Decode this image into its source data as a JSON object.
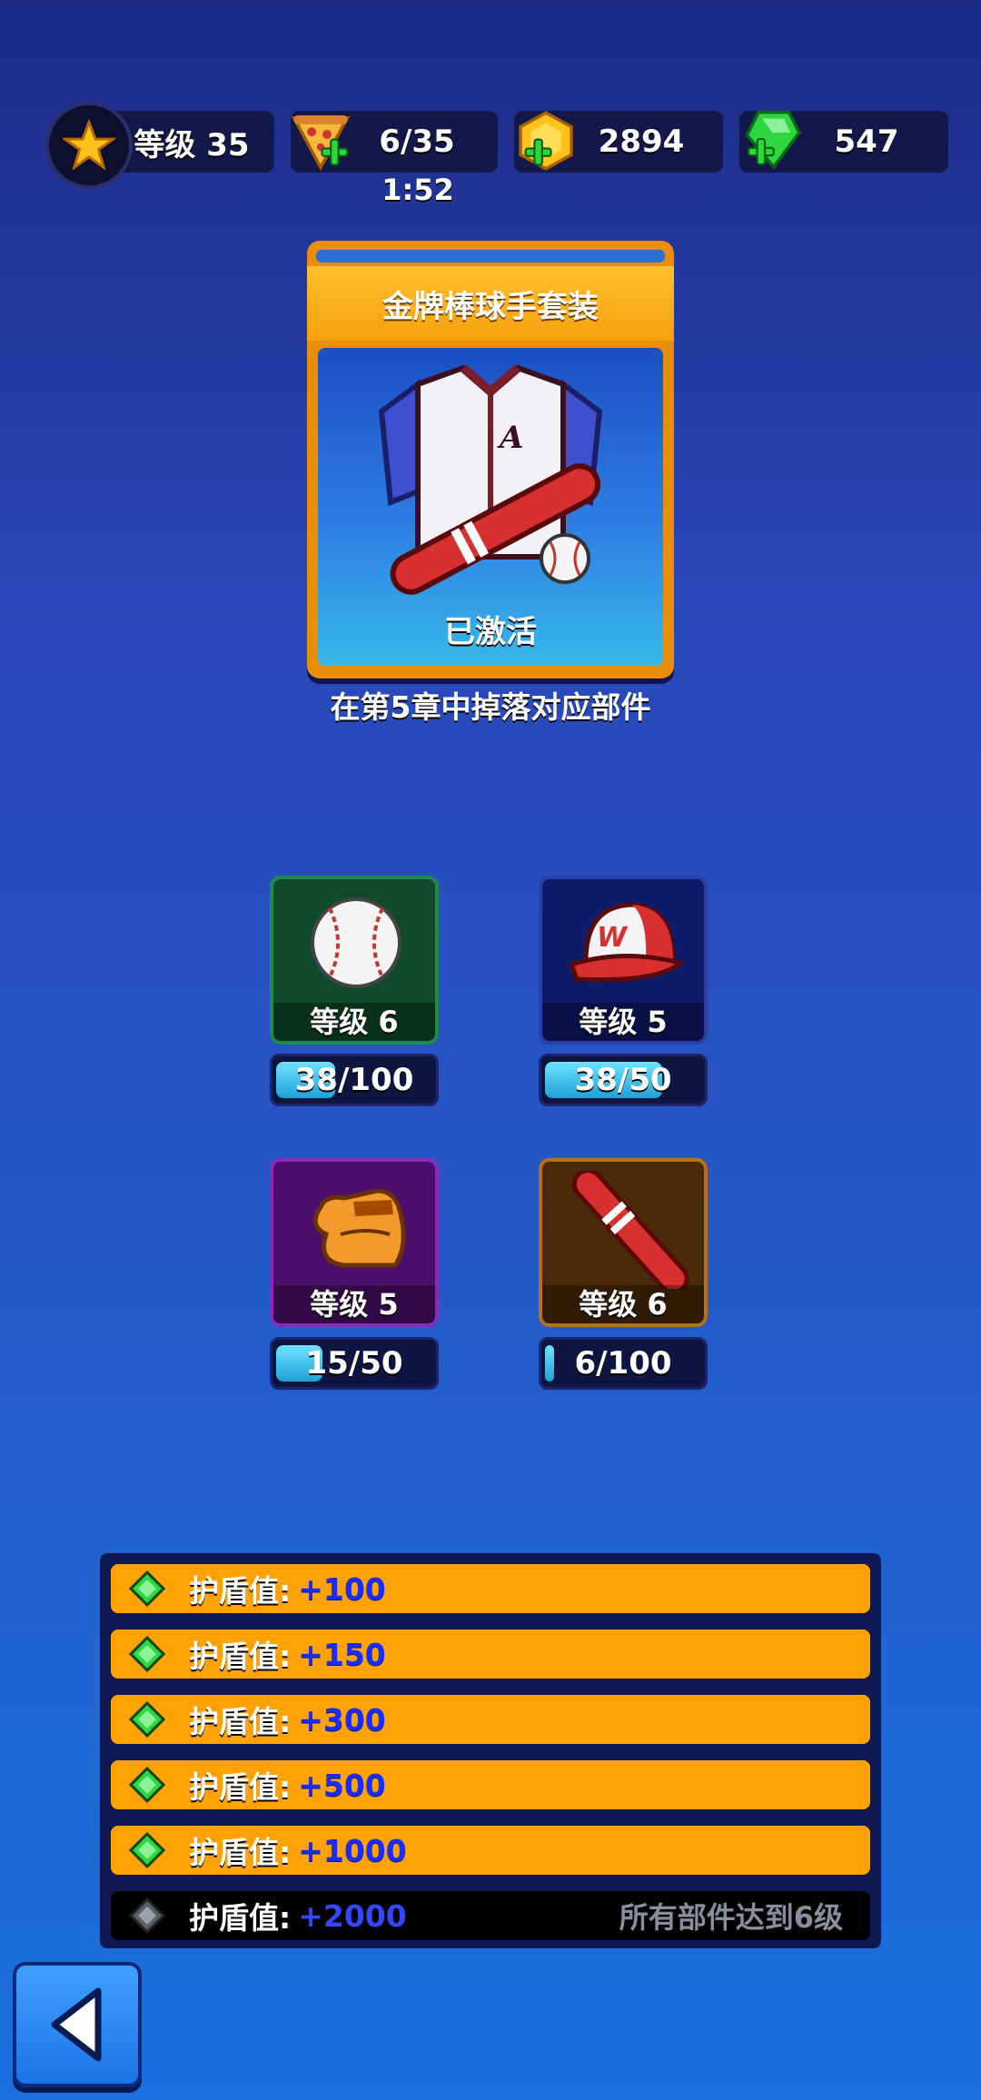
{
  "status_bar": {
    "level_label": "等级 35",
    "energy": "6/35",
    "energy_timer": "1:52",
    "coins": "2894",
    "gems": "547"
  },
  "set_card": {
    "title": "金牌棒球手套装",
    "status": "已激活",
    "drop_hint": "在第5章中掉落对应部件"
  },
  "parts": [
    {
      "name": "baseball",
      "level_label": "等级 6",
      "progress_text": "38/100",
      "progress": 0.38,
      "color": "#0f4a2c"
    },
    {
      "name": "cap",
      "level_label": "等级 5",
      "progress_text": "38/50",
      "progress": 0.76,
      "color": "#0d1b6a"
    },
    {
      "name": "glove",
      "level_label": "等级 5",
      "progress_text": "15/50",
      "progress": 0.3,
      "color": "#4b0f6b"
    },
    {
      "name": "bat",
      "level_label": "等级 6",
      "progress_text": "6/100",
      "progress": 0.06,
      "color": "#4a2a08"
    }
  ],
  "bonuses": [
    {
      "label": "护盾值:",
      "value": "+100",
      "active": true
    },
    {
      "label": "护盾值:",
      "value": "+150",
      "active": true
    },
    {
      "label": "护盾值:",
      "value": "+300",
      "active": true
    },
    {
      "label": "护盾值:",
      "value": "+500",
      "active": true
    },
    {
      "label": "护盾值:",
      "value": "+1000",
      "active": true
    },
    {
      "label": "护盾值:",
      "value": "+2000",
      "active": false,
      "requirement": "所有部件达到6级"
    }
  ],
  "icons": {
    "level": "star-icon",
    "energy": "pizza-icon",
    "coins": "coin-icon",
    "gems": "green-gem-icon",
    "back": "back-arrow-icon"
  }
}
